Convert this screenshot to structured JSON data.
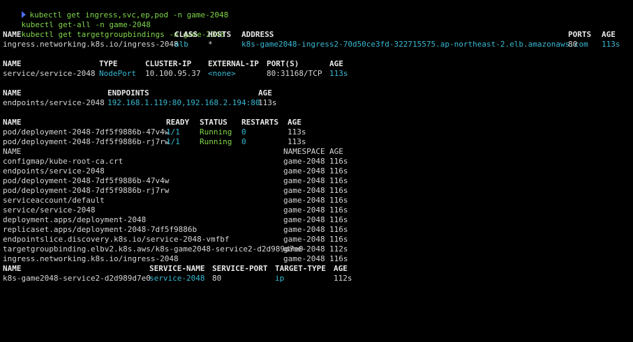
{
  "commands": [
    "kubectl get ingress,svc,ep,pod -n game-2048",
    "kubectl get-all -n game-2048",
    "kubectl get targetgroupbindings -n game-2048"
  ],
  "ingress": {
    "headers": [
      "NAME",
      "CLASS",
      "HOSTS",
      "ADDRESS",
      "PORTS",
      "AGE"
    ],
    "row": [
      "ingress.networking.k8s.io/ingress-2048",
      "alb",
      "*",
      "k8s-game2048-ingress2-70d50ce3fd-322715575.ap-northeast-2.elb.amazonaws.com",
      "80",
      "113s"
    ]
  },
  "service": {
    "headers": [
      "NAME",
      "TYPE",
      "CLUSTER-IP",
      "EXTERNAL-IP",
      "PORT(S)",
      "AGE"
    ],
    "row": [
      "service/service-2048",
      "NodePort",
      "10.100.95.37",
      "<none>",
      "80:31168/TCP",
      "113s"
    ]
  },
  "endpoints": {
    "headers": [
      "NAME",
      "ENDPOINTS",
      "AGE"
    ],
    "row": [
      "endpoints/service-2048",
      "192.168.1.119:80,192.168.2.194:80",
      "113s"
    ]
  },
  "pods": {
    "headers": [
      "NAME",
      "READY",
      "STATUS",
      "RESTARTS",
      "AGE"
    ],
    "rows": [
      [
        "pod/deployment-2048-7df5f9886b-47v4w",
        "1/1",
        "Running",
        "0",
        "113s"
      ],
      [
        "pod/deployment-2048-7df5f9886b-rj7rw",
        "1/1",
        "Running",
        "0",
        "113s"
      ]
    ]
  },
  "getall": {
    "headers": [
      "NAME",
      "NAMESPACE",
      "AGE"
    ],
    "rows": [
      [
        "configmap/kube-root-ca.crt",
        "game-2048",
        "116s"
      ],
      [
        "endpoints/service-2048",
        "game-2048",
        "116s"
      ],
      [
        "pod/deployment-2048-7df5f9886b-47v4w",
        "game-2048",
        "116s"
      ],
      [
        "pod/deployment-2048-7df5f9886b-rj7rw",
        "game-2048",
        "116s"
      ],
      [
        "serviceaccount/default",
        "game-2048",
        "116s"
      ],
      [
        "service/service-2048",
        "game-2048",
        "116s"
      ],
      [
        "deployment.apps/deployment-2048",
        "game-2048",
        "116s"
      ],
      [
        "replicaset.apps/deployment-2048-7df5f9886b",
        "game-2048",
        "116s"
      ],
      [
        "endpointslice.discovery.k8s.io/service-2048-vmfbf",
        "game-2048",
        "116s"
      ],
      [
        "targetgroupbinding.elbv2.k8s.aws/k8s-game2048-service2-d2d989d7e0",
        "game-2048",
        "112s"
      ],
      [
        "ingress.networking.k8s.io/ingress-2048",
        "game-2048",
        "116s"
      ]
    ]
  },
  "tgb": {
    "headers": [
      "NAME",
      "SERVICE-NAME",
      "SERVICE-PORT",
      "TARGET-TYPE",
      "AGE"
    ],
    "row": [
      "k8s-game2048-service2-d2d989d7e0",
      "service-2048",
      "80",
      "ip",
      "112s"
    ]
  },
  "colors": {
    "green": "#7fd64a",
    "cyan": "#37b9d4",
    "prompt_arrow": "#4a6df0"
  }
}
